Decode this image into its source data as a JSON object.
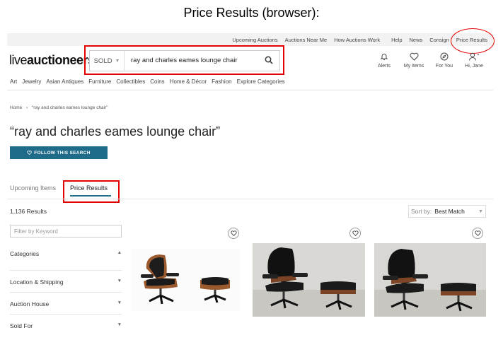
{
  "caption": "Price Results (browser):",
  "top_nav": {
    "links": [
      "Upcoming Auctions",
      "Auctions Near Me",
      "How Auctions Work",
      "Help",
      "News",
      "Consign",
      "Price Results"
    ]
  },
  "logo": {
    "light": "live",
    "bold": "auctioneers"
  },
  "search": {
    "status": "SOLD",
    "query": "ray and charles eames lounge chair"
  },
  "user_menu": {
    "alerts": "Alerts",
    "my_items": "My Items",
    "for_you": "For You",
    "user": "Hi, Jane"
  },
  "categories": [
    "Art",
    "Jewelry",
    "Asian Antiques",
    "Furniture",
    "Collectibles",
    "Coins",
    "Home & Décor",
    "Fashion",
    "Explore Categories"
  ],
  "breadcrumb": {
    "home": "Home",
    "sep": "›",
    "current": "“ray and charles eames lounge chair”"
  },
  "page_title": "“ray and charles eames lounge chair”",
  "follow_button": "FOLLOW THIS SEARCH",
  "tabs": {
    "upcoming": "Upcoming Items",
    "price_results": "Price Results"
  },
  "results_count": "1,136 Results",
  "sort": {
    "label": "Sort by:",
    "value": "Best Match"
  },
  "filter_placeholder": "Filter by Keyword",
  "facets": [
    "Categories",
    "Location & Shipping",
    "Auction House",
    "Sold For"
  ],
  "colors": {
    "accent": "#1f6b8a",
    "annotation": "#e30000"
  }
}
